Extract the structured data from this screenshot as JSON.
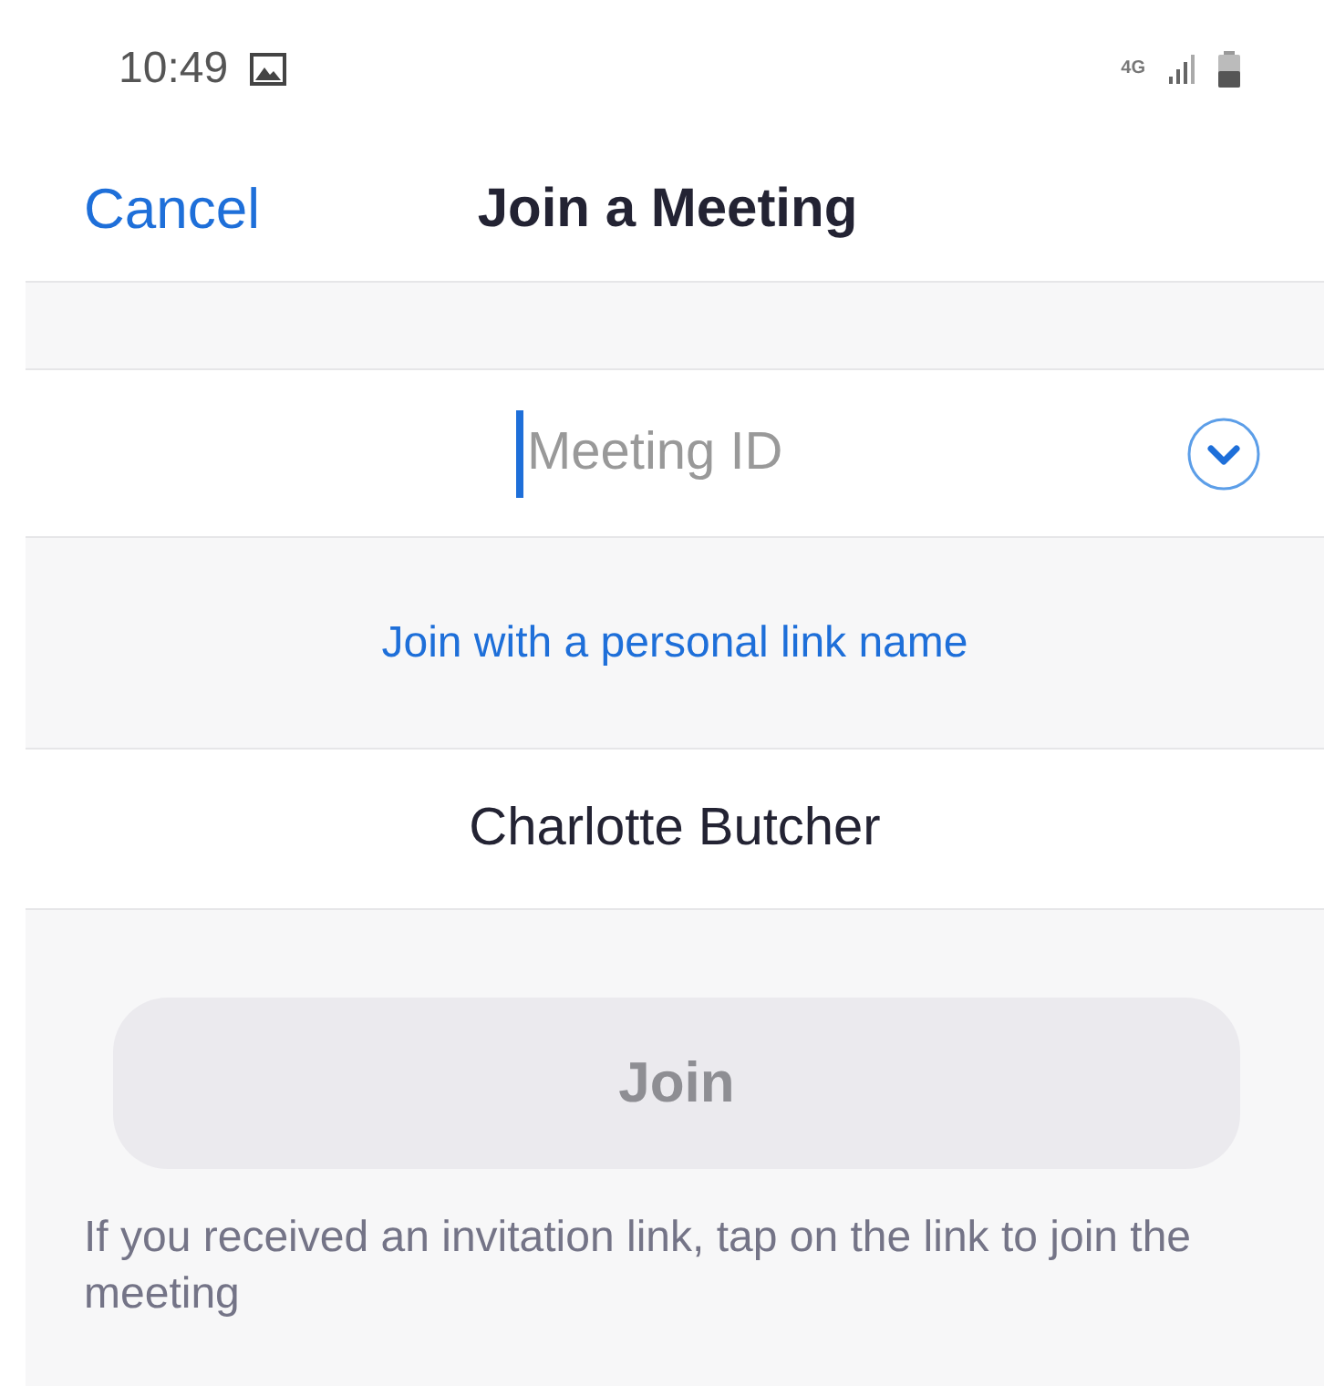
{
  "status_bar": {
    "time": "10:49",
    "network": "4G"
  },
  "header": {
    "cancel": "Cancel",
    "title": "Join a Meeting"
  },
  "meeting_id_field": {
    "placeholder": "Meeting ID",
    "focused": true
  },
  "personal_link": "Join with a personal link name",
  "name_field": {
    "value": "Charlotte Butcher"
  },
  "join_button": {
    "label": "Join",
    "disabled": true
  },
  "hint": "If you received an invitation link, tap on the link to join the meeting"
}
